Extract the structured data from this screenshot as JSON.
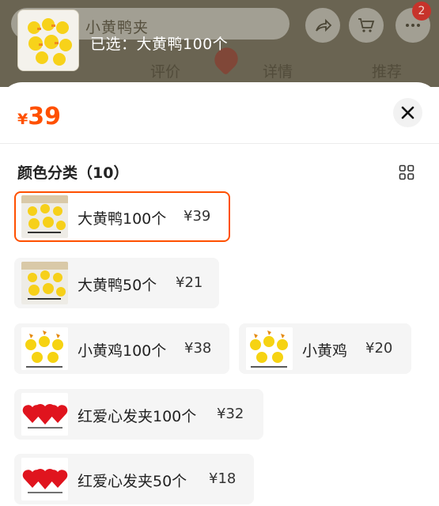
{
  "background": {
    "search_text": "小黄鸭夹",
    "tabs": [
      "评价",
      "详情",
      "推荐"
    ],
    "cart_badge": "2",
    "selected_label": "已选：大黄鸭100个"
  },
  "sheet": {
    "price_currency": "¥",
    "price_value": "39",
    "section_title": "颜色分类（10）",
    "options": [
      {
        "name": "大黄鸭100个",
        "price": "¥39",
        "selected": true,
        "image": "yellow-duck-clips"
      },
      {
        "name": "大黄鸭50个",
        "price": "¥21",
        "selected": false,
        "image": "yellow-duck-clips"
      },
      {
        "name": "小黄鸡100个",
        "price": "¥38",
        "selected": false,
        "image": "yellow-chick-clips"
      },
      {
        "name": "小黄鸡",
        "price": "¥20",
        "selected": false,
        "image": "yellow-chick-clips"
      },
      {
        "name": "红爱心发夹100个",
        "price": "¥32",
        "selected": false,
        "image": "red-heart-clips"
      },
      {
        "name": "红爱心发夹50个",
        "price": "¥18",
        "selected": false,
        "image": "red-heart-clips"
      }
    ]
  }
}
